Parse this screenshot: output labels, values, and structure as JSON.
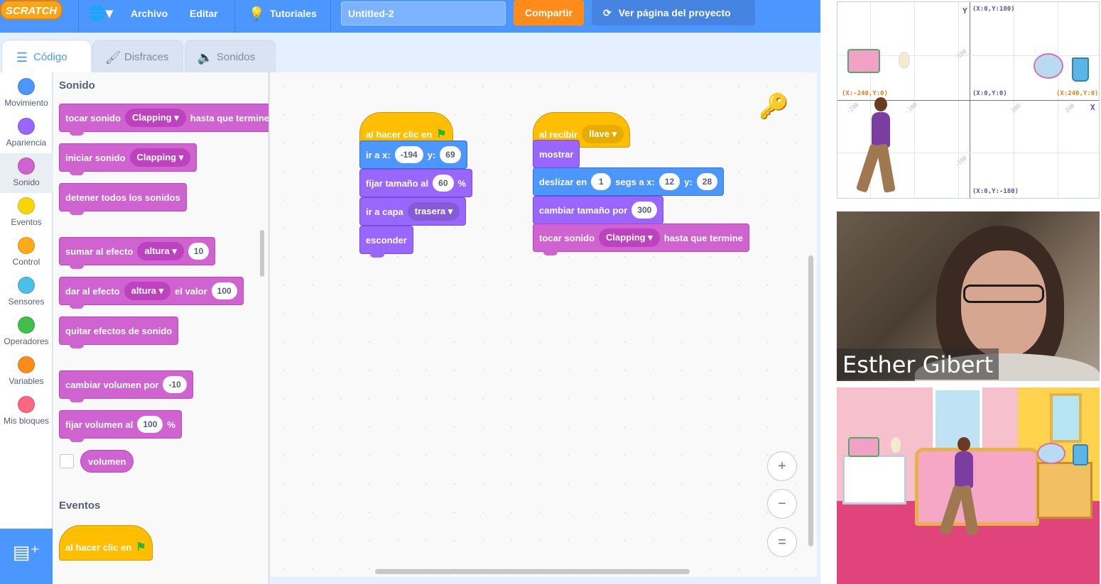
{
  "menubar": {
    "logo": "SCRATCH",
    "archivo": "Archivo",
    "editar": "Editar",
    "tutoriales": "Tutoriales",
    "project_title": "Untitled-2",
    "share": "Compartir",
    "project_page": "Ver página del proyecto"
  },
  "tabs": {
    "code": "Código",
    "costumes": "Disfraces",
    "sounds": "Sonidos"
  },
  "categories": [
    {
      "label": "Movimiento",
      "color": "#4c97ff"
    },
    {
      "label": "Apariencia",
      "color": "#9966ff"
    },
    {
      "label": "Sonido",
      "color": "#cf63cf"
    },
    {
      "label": "Eventos",
      "color": "#ffd500"
    },
    {
      "label": "Control",
      "color": "#ffab19"
    },
    {
      "label": "Sensores",
      "color": "#4cbfe6"
    },
    {
      "label": "Operadores",
      "color": "#40bf4a"
    },
    {
      "label": "Variables",
      "color": "#ff8c1a"
    },
    {
      "label": "Mis bloques",
      "color": "#ff6680"
    }
  ],
  "palette": {
    "heading_sound": "Sonido",
    "play_until_done": {
      "text1": "tocar sonido",
      "sound": "Clapping",
      "text2": "hasta que termine"
    },
    "start_sound": {
      "text1": "iniciar sonido",
      "sound": "Clapping"
    },
    "stop_all": "detener todos los sonidos",
    "change_effect": {
      "text1": "sumar al efecto",
      "effect": "altura",
      "value": "10"
    },
    "set_effect": {
      "text1": "dar al efecto",
      "effect": "altura",
      "text2": "el valor",
      "value": "100"
    },
    "clear_effects": "quitar efectos de sonido",
    "change_volume": {
      "text1": "cambiar volumen por",
      "value": "-10"
    },
    "set_volume": {
      "text1": "fijar volumen al",
      "value": "100",
      "unit": "%"
    },
    "volume_reporter": "volumen",
    "heading_events": "Eventos",
    "when_flag": "al hacer clic en"
  },
  "script1": {
    "hat": "al hacer clic en",
    "goto": {
      "text1": "ir a x:",
      "x": "-194",
      "text2": "y:",
      "y": "69"
    },
    "set_size": {
      "text1": "fijar tamaño al",
      "value": "60",
      "unit": "%"
    },
    "go_layer": {
      "text1": "ir a capa",
      "layer": "trasera"
    },
    "hide": "esconder"
  },
  "script2": {
    "hat": {
      "text1": "al recibir",
      "message": "llave"
    },
    "show": "mostrar",
    "glide": {
      "text1": "deslizar en",
      "secs": "1",
      "text2": "segs a x:",
      "x": "12",
      "text3": "y:",
      "y": "28"
    },
    "change_size": {
      "text1": "cambiar tamaño por",
      "value": "300"
    },
    "play_sound": {
      "text1": "tocar sonido",
      "sound": "Clapping",
      "text2": "hasta que termine"
    }
  },
  "zoom": {
    "in": "+",
    "out": "−",
    "reset": "="
  },
  "stage": {
    "y_label": "Y",
    "x_label": "X",
    "top": "(X:0,Y:180)",
    "bottom": "(X:0,Y:-180)",
    "left": "(X:-240,Y:0)",
    "right": "(X:240,Y:0)",
    "origin": "(X:0,Y:0)",
    "ticks": [
      "-200",
      "-100",
      "100",
      "200",
      "100",
      "-100"
    ]
  },
  "webcam": {
    "name": "Esther Gibert"
  }
}
